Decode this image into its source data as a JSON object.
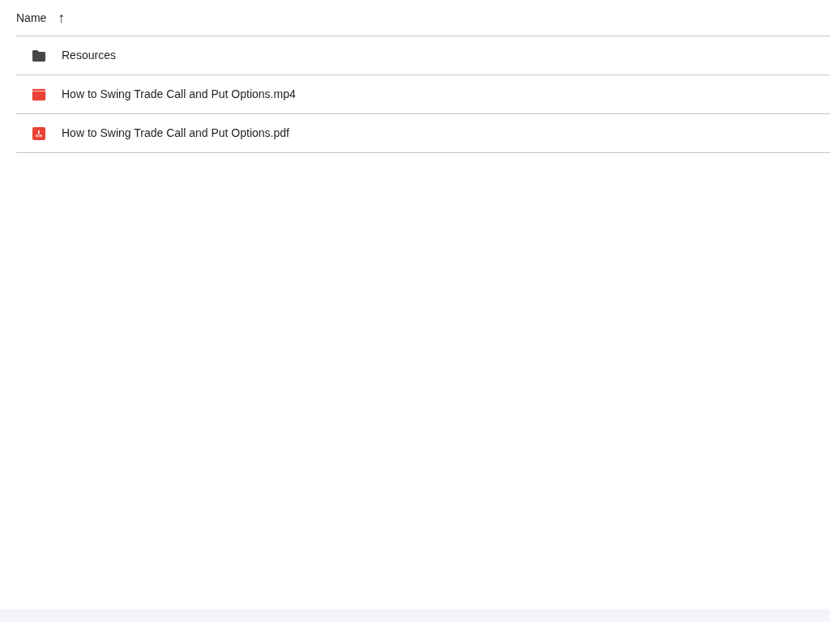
{
  "header": {
    "label": "Name",
    "sort_arrow": "↑"
  },
  "files": [
    {
      "kind": "folder",
      "name": "Resources"
    },
    {
      "kind": "video",
      "name": "How to Swing Trade Call and Put Options.mp4"
    },
    {
      "kind": "pdf",
      "name": "How to Swing Trade Call and Put Options.pdf"
    }
  ]
}
